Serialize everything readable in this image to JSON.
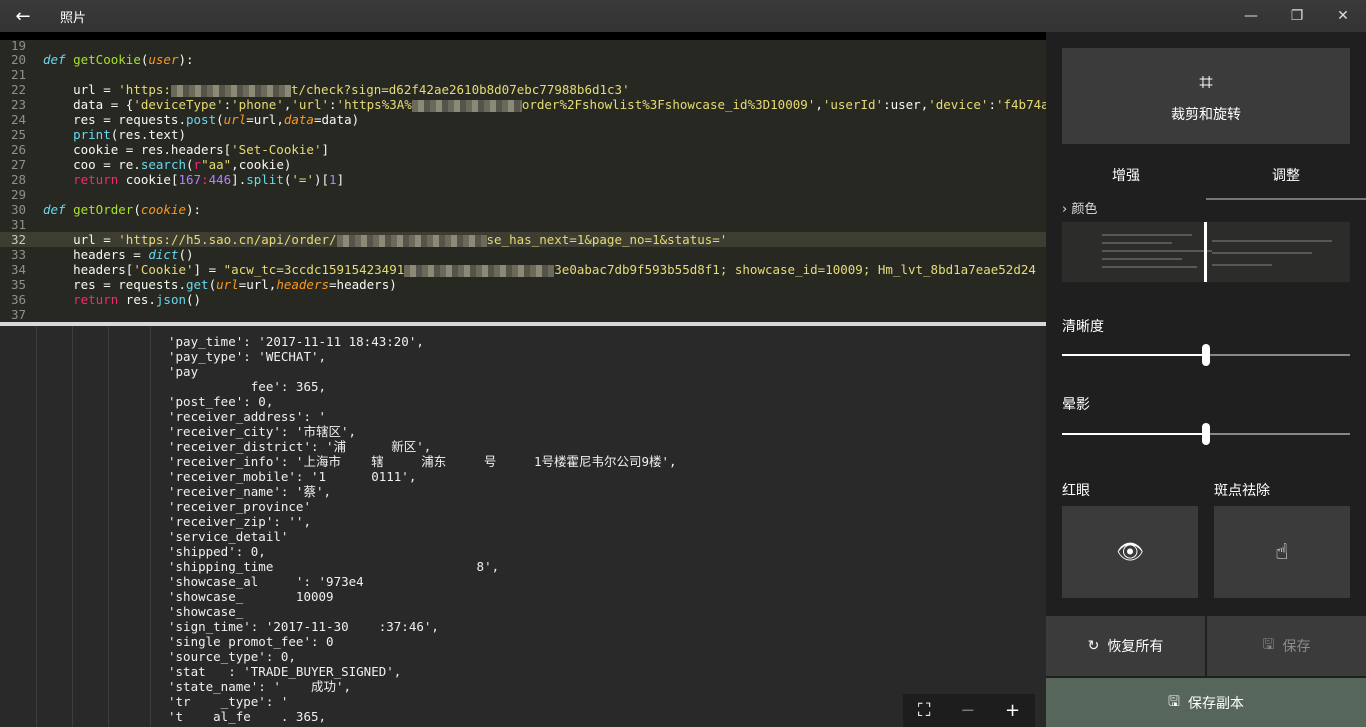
{
  "window": {
    "title": "照片",
    "back_icon": "←",
    "minimize": "—",
    "maximize": "❐",
    "close": "✕"
  },
  "code": {
    "lines": [
      {
        "n": "19"
      },
      {
        "n": "20"
      },
      {
        "n": "21"
      },
      {
        "n": "22",
        "pre": "    url = ",
        "s1": "'https:",
        "s2": "t/check?sign=d62f42ae2610b8d07ebc77988b6d1c3'"
      },
      {
        "n": "23"
      },
      {
        "n": "24"
      },
      {
        "n": "25"
      },
      {
        "n": "26"
      },
      {
        "n": "27"
      },
      {
        "n": "28"
      },
      {
        "n": "29"
      },
      {
        "n": "30"
      },
      {
        "n": "31"
      },
      {
        "n": "32"
      },
      {
        "n": "33"
      },
      {
        "n": "34"
      },
      {
        "n": "35"
      },
      {
        "n": "36"
      },
      {
        "n": "37"
      }
    ],
    "text": {
      "l20_def": "def ",
      "l20_fn": "getCookie",
      "l20_p": "user",
      "l23_a": "    data = {",
      "l23_b": "'deviceType'",
      "l23_c": ":",
      "l23_d": "'phone'",
      "l23_e": ",",
      "l23_f": "'url'",
      "l23_g": ":",
      "l23_h": "'https%3A%",
      "l23_i": "order%2Fshowlist%3Fshowcase_id%3D10009'",
      "l23_j": ",",
      "l23_k": "'userId'",
      "l23_l": ":user,",
      "l23_m": "'device'",
      "l23_n": ":",
      "l23_o": "'f4b74a",
      "l24_a": "    res = requests.",
      "l24_b": "post",
      "l24_c": "(",
      "l24_d": "url",
      "l24_e": "=url,",
      "l24_f": "data",
      "l24_g": "=data)",
      "l25_a": "    ",
      "l25_b": "print",
      "l25_c": "(res.text)",
      "l26_a": "    cookie = res.headers[",
      "l26_b": "'Set-Cookie'",
      "l26_c": "]",
      "l27_a": "    coo = re.",
      "l27_b": "search",
      "l27_c": "(",
      "l27_d": "r",
      "l27_e": "\"aa\"",
      "l27_f": ",cookie)",
      "l28_a": "    ",
      "l28_b": "return",
      "l28_c": " cookie[",
      "l28_d": "167",
      "l28_e": ":",
      "l28_f": "446",
      "l28_g": "].",
      "l28_h": "split",
      "l28_i": "(",
      "l28_j": "'='",
      "l28_k": ")[",
      "l28_l": "1",
      "l28_m": "]",
      "l30_def": "def ",
      "l30_fn": "getOrder",
      "l30_p": "cookie",
      "l32_a": "    url = ",
      "l32_b": "'https://h5.sao.cn/api/order/",
      "l32_c": "se_has_next=1&page_no=1&status='",
      "l33_a": "    headers = ",
      "l33_b": "dict",
      "l33_c": "()",
      "l34_a": "    headers[",
      "l34_b": "'Cookie'",
      "l34_c": "] = ",
      "l34_d": "\"acw_tc=3ccdc15915423491",
      "l34_e": "3e0abac7db9f593b55d8f1; showcase_id=10009; Hm_lvt_8bd1a7eae52d24",
      "l35_a": "    res = requests.",
      "l35_b": "get",
      "l35_c": "(",
      "l35_d": "url",
      "l35_e": "=url,",
      "l35_f": "headers",
      "l35_g": "=headers)",
      "l36_a": "    ",
      "l36_b": "return",
      "l36_c": " res.",
      "l36_d": "json",
      "l36_e": "()"
    }
  },
  "console": [
    "'pay_time': '2017-11-11 18:43:20',",
    "'pay_type': 'WECHAT',",
    "'pay",
    "           fee': 365,",
    "'post_fee': 0,",
    "'receiver_address': '",
    "'receiver_city': '市辖区',",
    "'receiver_district': '浦      新区',",
    "'receiver_info': '上海市    辖     浦东     号     1号楼霍尼韦尔公司9楼',",
    "'receiver_mobile': '1      0111',",
    "'receiver_name': '蔡',",
    "'receiver_province'",
    "'receiver_zip': '',",
    "'service_detail'",
    "'shipped': 0,",
    "'shipping_time                           8',",
    "'showcase_al     ': '973e4",
    "'showcase_       10009",
    "'showcase_",
    "'sign_time': '2017-11-30    :37:46',",
    "'single promot_fee': 0",
    "'source_type': 0,",
    "'stat   : 'TRADE_BUYER_SIGNED',",
    "'state_name': '    成功',",
    "'tr    _type': '",
    "'t    al_fe    . 365,"
  ],
  "zoom": {
    "fit": "⛶",
    "minus": "−",
    "plus": "+"
  },
  "panel": {
    "crop_icon": "⌗",
    "crop_label": "裁剪和旋转",
    "tab_enhance": "增强",
    "tab_adjust": "调整",
    "color_label": "颜色",
    "clarity_label": "清晰度",
    "clarity_value": 0.5,
    "vignette_label": "晕影",
    "vignette_value": 0.5,
    "redeye_label": "红眼",
    "spot_label": "斑点祛除",
    "eye_icon": "👁",
    "touch_icon": "☝",
    "revert_icon": "↻",
    "revert_label": "恢复所有",
    "save_icon": "🖫",
    "save_label": "保存",
    "save_copy_icon": "🖫",
    "save_copy_label": "保存副本"
  }
}
